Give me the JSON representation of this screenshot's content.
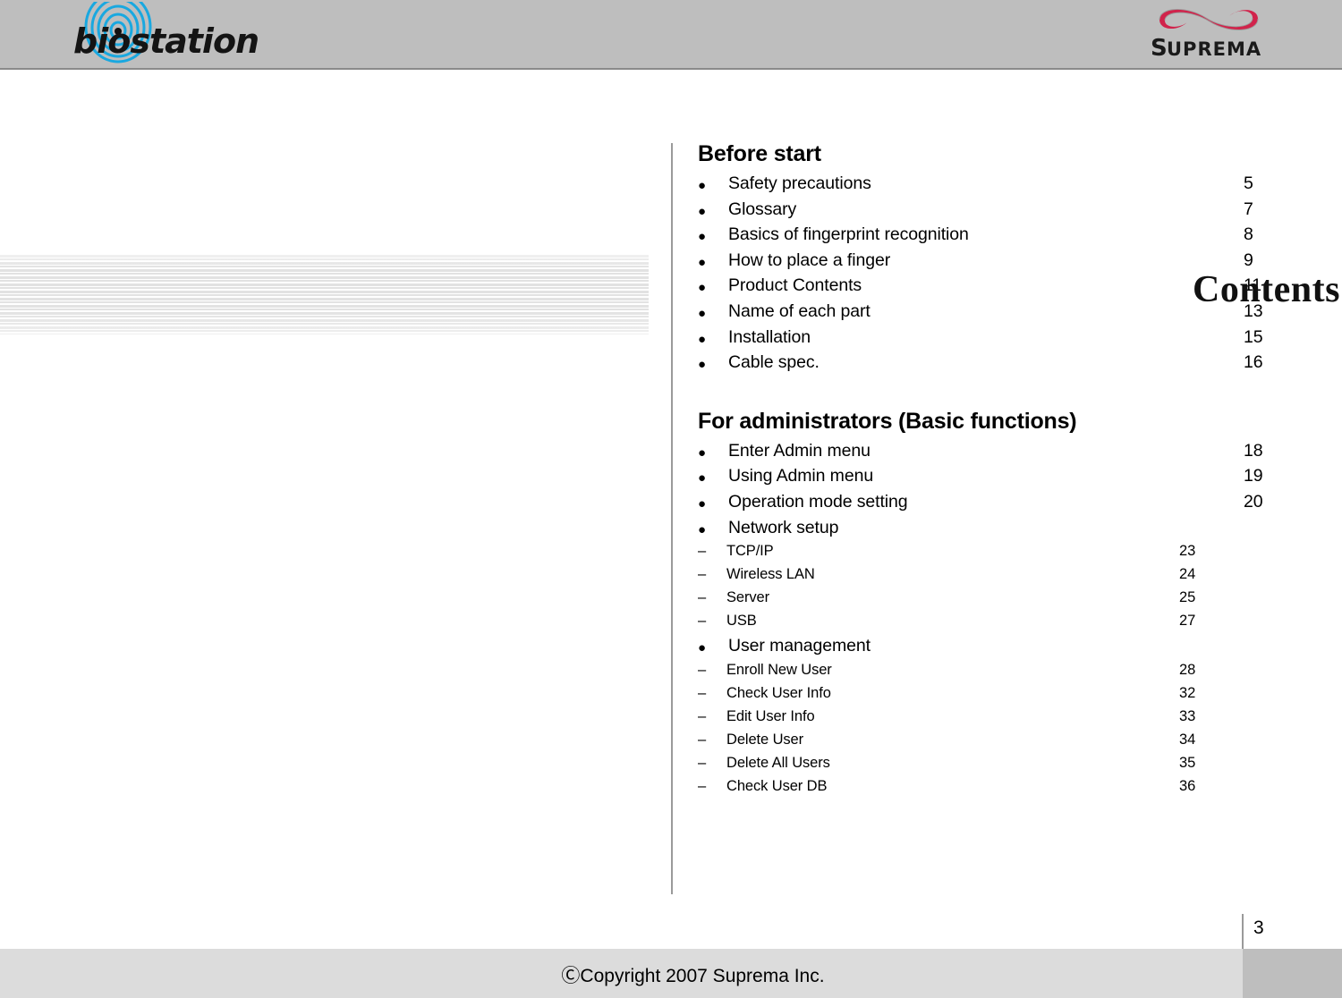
{
  "header": {
    "brand_logo": "biostation-logo",
    "brand_name": "biostation",
    "company_logo": "suprema-logo",
    "company_name": "SUPREMA",
    "brand_accent_color": "#19A8E0",
    "company_accent_color": "#D1234B",
    "band_color": "#BEBEBE"
  },
  "title": {
    "text": "Contents"
  },
  "toc": {
    "sections": [
      {
        "heading": "Before start",
        "items": [
          {
            "marker": "●",
            "label": "Safety precautions",
            "page": "5",
            "level": 1
          },
          {
            "marker": "●",
            "label": "Glossary",
            "page": "7",
            "level": 1
          },
          {
            "marker": "●",
            "label": "Basics of fingerprint recognition",
            "page": "8",
            "level": 1
          },
          {
            "marker": "●",
            "label": "How to place a finger",
            "page": "9",
            "level": 1
          },
          {
            "marker": "●",
            "label": "Product Contents",
            "page": "11",
            "level": 1
          },
          {
            "marker": "●",
            "label": "Name of each part",
            "page": "13",
            "level": 1
          },
          {
            "marker": "●",
            "label": "Installation",
            "page": "15",
            "level": 1
          },
          {
            "marker": "●",
            "label": "Cable spec.",
            "page": "16",
            "level": 1
          }
        ]
      },
      {
        "heading": "For administrators (Basic functions)",
        "items": [
          {
            "marker": "●",
            "label": "Enter Admin menu",
            "page": "18",
            "level": 1
          },
          {
            "marker": "●",
            "label": "Using Admin menu",
            "page": "19",
            "level": 1
          },
          {
            "marker": "●",
            "label": "Operation mode setting",
            "page": "20",
            "level": 1
          },
          {
            "marker": "●",
            "label": "Network setup",
            "page": "",
            "level": 1
          },
          {
            "marker": "–",
            "label": "TCP/IP",
            "page": "23",
            "level": 2
          },
          {
            "marker": "–",
            "label": "Wireless LAN",
            "page": "24",
            "level": 2
          },
          {
            "marker": "–",
            "label": "Server",
            "page": "25",
            "level": 2
          },
          {
            "marker": "–",
            "label": "USB",
            "page": "27",
            "level": 2
          },
          {
            "marker": "●",
            "label": "User management",
            "page": "",
            "level": 1
          },
          {
            "marker": "–",
            "label": "Enroll New User",
            "page": "28",
            "level": 2
          },
          {
            "marker": "–",
            "label": "Check User Info",
            "page": "32",
            "level": 2
          },
          {
            "marker": "–",
            "label": "Edit User Info",
            "page": "33",
            "level": 2
          },
          {
            "marker": "–",
            "label": "Delete User",
            "page": "34",
            "level": 2
          },
          {
            "marker": "–",
            "label": "Delete All Users",
            "page": "35",
            "level": 2
          },
          {
            "marker": "–",
            "label": "Check User DB",
            "page": "36",
            "level": 2
          }
        ]
      }
    ]
  },
  "footer": {
    "page_number": "3",
    "copyright": "ⒸCopyright 2007 Suprema Inc.",
    "band_color_left": "#DCDCDC",
    "band_color_right": "#BEBEBE"
  }
}
